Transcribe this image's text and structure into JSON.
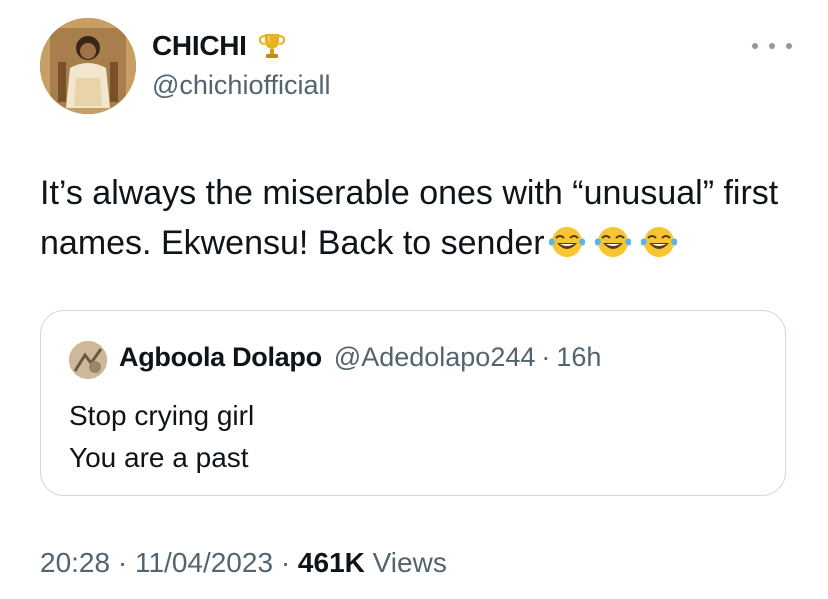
{
  "author": {
    "display_name": "CHICHI",
    "badge_icon": "trophy-icon",
    "handle": "@chichiofficiall"
  },
  "tweet": {
    "text": "It’s always the miserable ones with “unusual” first names. Ekwensu! Back to sender",
    "emojis": [
      "face-with-tears-of-joy",
      "face-with-tears-of-joy",
      "face-with-tears-of-joy"
    ]
  },
  "quote": {
    "display_name": "Agboola Dolapo",
    "handle": "@Adedolapo244",
    "separator": "·",
    "time": "16h",
    "lines": [
      "Stop crying girl",
      "You are a past"
    ]
  },
  "footer": {
    "time": "20:28",
    "sep1": "·",
    "date": "11/04/2023",
    "sep2": "·",
    "views_count": "461K",
    "views_label": "Views"
  },
  "colors": {
    "primary_text": "#0f1419",
    "secondary_text": "#536471",
    "border": "#cfd9de"
  }
}
